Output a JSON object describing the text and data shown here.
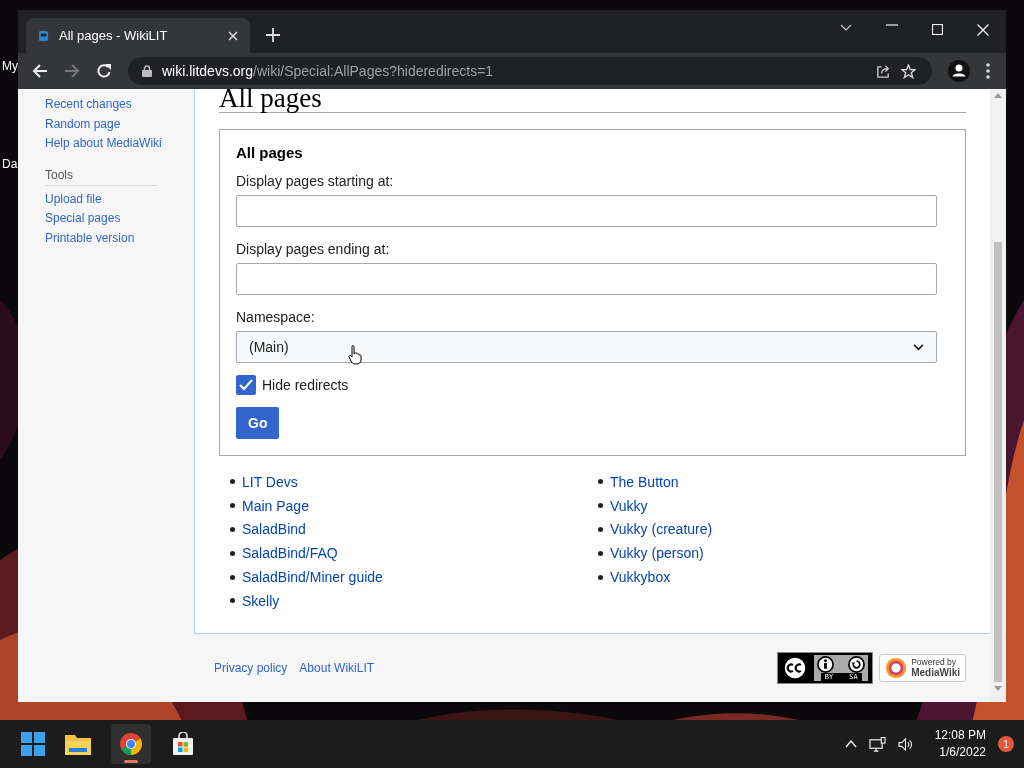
{
  "desktop": {
    "icon_labels": [
      "My",
      "Da"
    ]
  },
  "browser": {
    "tabs": [
      {
        "title": "All pages - WikiLIT",
        "selected": true
      }
    ],
    "address": {
      "domain": "wiki.litdevs.org",
      "path": "/wiki/Special:AllPages?hideredirects=1"
    }
  },
  "sidebar": {
    "navigation": [
      "Recent changes",
      "Random page",
      "Help about MediaWiki"
    ],
    "tools_heading": "Tools",
    "tools": [
      "Upload file",
      "Special pages",
      "Printable version"
    ]
  },
  "page": {
    "title": "All pages",
    "form": {
      "legend": "All pages",
      "fields": [
        {
          "label": "Display pages starting at:",
          "kind": "text"
        },
        {
          "label": "Display pages ending at:",
          "kind": "text"
        },
        {
          "label": "Namespace:",
          "kind": "select",
          "value": "(Main)"
        }
      ],
      "checkbox": {
        "label": "Hide redirects",
        "checked": true
      },
      "submit": "Go"
    },
    "columns": [
      [
        "LIT Devs",
        "Main Page",
        "SaladBind",
        "SaladBind/FAQ",
        "SaladBind/Miner guide",
        "Skelly"
      ],
      [
        "The Button",
        "Vukky",
        "Vukky (creature)",
        "Vukky (person)",
        "Vukkybox"
      ]
    ]
  },
  "footer": {
    "links": [
      "Privacy policy",
      "About WikiLIT"
    ],
    "license_badge": [
      "BY",
      "SA"
    ],
    "powered_by": [
      "Powered by",
      "MediaWiki"
    ]
  },
  "taskbar": {
    "time": "12:08 PM",
    "date": "1/6/2022",
    "notification_count": "1"
  }
}
